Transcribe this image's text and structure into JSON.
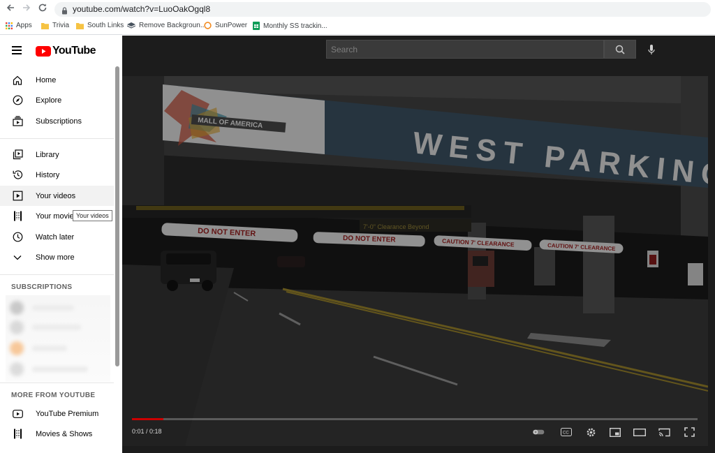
{
  "browser": {
    "url": "youtube.com/watch?v=LuoOakOgql8",
    "bookmarks": [
      {
        "label": "Apps",
        "icon": "apps-grid-icon"
      },
      {
        "label": "Trivia",
        "icon": "folder-icon"
      },
      {
        "label": "South Links",
        "icon": "folder-icon"
      },
      {
        "label": "Remove Backgroun...",
        "icon": "layers-icon"
      },
      {
        "label": "SunPower",
        "icon": "circle-icon"
      },
      {
        "label": "Monthly SS trackin...",
        "icon": "sheets-icon"
      }
    ]
  },
  "header": {
    "logo_text": "YouTube",
    "search_placeholder": "Search"
  },
  "sidebar": {
    "items": [
      {
        "label": "Home",
        "icon": "home-icon"
      },
      {
        "label": "Explore",
        "icon": "compass-icon"
      },
      {
        "label": "Subscriptions",
        "icon": "subscriptions-icon"
      },
      {
        "label": "Library",
        "icon": "library-icon"
      },
      {
        "label": "History",
        "icon": "history-icon"
      },
      {
        "label": "Your videos",
        "icon": "your-videos-icon",
        "active": true
      },
      {
        "label": "Your movies",
        "icon": "film-icon"
      },
      {
        "label": "Watch later",
        "icon": "clock-icon"
      },
      {
        "label": "Show more",
        "icon": "chevron-down-icon"
      }
    ],
    "tooltip": "Your videos",
    "subscriptions_title": "SUBSCRIPTIONS",
    "more_title": "MORE FROM YOUTUBE",
    "more_items": [
      {
        "label": "YouTube Premium",
        "icon": "youtube-premium-icon"
      },
      {
        "label": "Movies & Shows",
        "icon": "film-icon"
      }
    ]
  },
  "video": {
    "scene_text": {
      "sign_main": "WEST PARKING",
      "brand": "MALL OF AMERICA",
      "barrier_1": "DO NOT ENTER",
      "barrier_2": "DO NOT ENTER",
      "barrier_3": "CAUTION 7' CLEARANCE",
      "barrier_4": "CAUTION 7' CLEARANCE",
      "clearance_banner": "7'-0\" Clearance Beyond"
    },
    "time": "0:01 / 0:18",
    "progress_fraction": 0.056,
    "controls": [
      "autoplay-toggle-icon",
      "captions-icon",
      "settings-gear-icon",
      "miniplayer-icon",
      "theater-mode-icon",
      "cast-icon",
      "fullscreen-icon"
    ]
  },
  "colors": {
    "yt_red": "#ff0000",
    "overlay": "#1c1c1c",
    "sign_blue": "#3e5566"
  }
}
